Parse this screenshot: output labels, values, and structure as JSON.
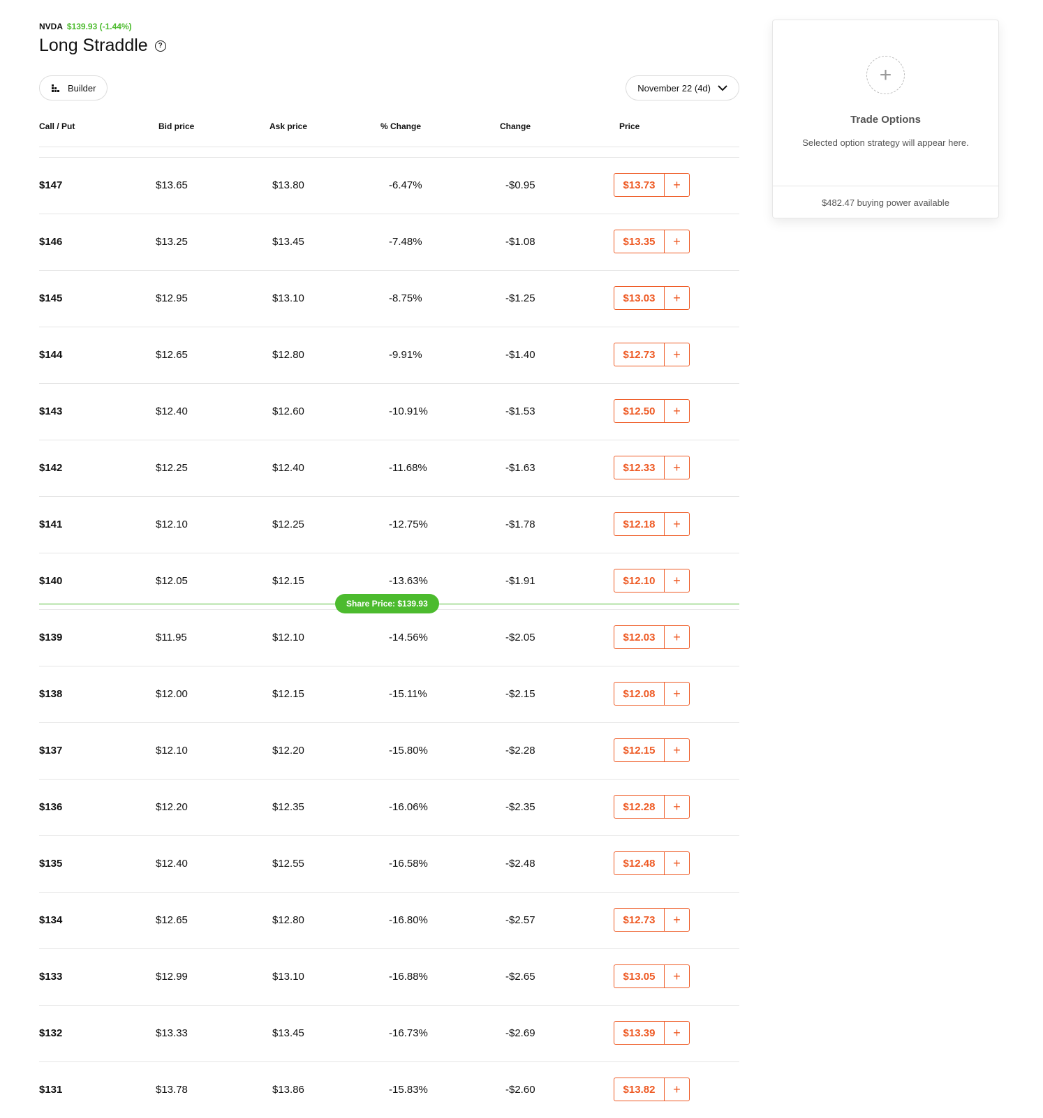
{
  "ticker": {
    "symbol": "NVDA",
    "quote": "$139.93 (-1.44%)"
  },
  "page": {
    "title": "Long Straddle",
    "help_glyph": "?"
  },
  "controls": {
    "builder_label": "Builder",
    "expiry_label": "November 22 (4d)"
  },
  "columns": [
    "Call / Put",
    "Bid price",
    "Ask price",
    "% Change",
    "Change",
    "Price"
  ],
  "rows": [
    {
      "strike": "$147",
      "bid": "$13.65",
      "ask": "$13.80",
      "pct_change": "-6.47%",
      "change": "-$0.95",
      "price": "$13.73"
    },
    {
      "strike": "$146",
      "bid": "$13.25",
      "ask": "$13.45",
      "pct_change": "-7.48%",
      "change": "-$1.08",
      "price": "$13.35"
    },
    {
      "strike": "$145",
      "bid": "$12.95",
      "ask": "$13.10",
      "pct_change": "-8.75%",
      "change": "-$1.25",
      "price": "$13.03"
    },
    {
      "strike": "$144",
      "bid": "$12.65",
      "ask": "$12.80",
      "pct_change": "-9.91%",
      "change": "-$1.40",
      "price": "$12.73"
    },
    {
      "strike": "$143",
      "bid": "$12.40",
      "ask": "$12.60",
      "pct_change": "-10.91%",
      "change": "-$1.53",
      "price": "$12.50"
    },
    {
      "strike": "$142",
      "bid": "$12.25",
      "ask": "$12.40",
      "pct_change": "-11.68%",
      "change": "-$1.63",
      "price": "$12.33"
    },
    {
      "strike": "$141",
      "bid": "$12.10",
      "ask": "$12.25",
      "pct_change": "-12.75%",
      "change": "-$1.78",
      "price": "$12.18"
    },
    {
      "strike": "$140",
      "bid": "$12.05",
      "ask": "$12.15",
      "pct_change": "-13.63%",
      "change": "-$1.91",
      "price": "$12.10"
    },
    {
      "strike": "$139",
      "bid": "$11.95",
      "ask": "$12.10",
      "pct_change": "-14.56%",
      "change": "-$2.05",
      "price": "$12.03"
    },
    {
      "strike": "$138",
      "bid": "$12.00",
      "ask": "$12.15",
      "pct_change": "-15.11%",
      "change": "-$2.15",
      "price": "$12.08"
    },
    {
      "strike": "$137",
      "bid": "$12.10",
      "ask": "$12.20",
      "pct_change": "-15.80%",
      "change": "-$2.28",
      "price": "$12.15"
    },
    {
      "strike": "$136",
      "bid": "$12.20",
      "ask": "$12.35",
      "pct_change": "-16.06%",
      "change": "-$2.35",
      "price": "$12.28"
    },
    {
      "strike": "$135",
      "bid": "$12.40",
      "ask": "$12.55",
      "pct_change": "-16.58%",
      "change": "-$2.48",
      "price": "$12.48"
    },
    {
      "strike": "$134",
      "bid": "$12.65",
      "ask": "$12.80",
      "pct_change": "-16.80%",
      "change": "-$2.57",
      "price": "$12.73"
    },
    {
      "strike": "$133",
      "bid": "$12.99",
      "ask": "$13.10",
      "pct_change": "-16.88%",
      "change": "-$2.65",
      "price": "$13.05"
    },
    {
      "strike": "$132",
      "bid": "$13.33",
      "ask": "$13.45",
      "pct_change": "-16.73%",
      "change": "-$2.69",
      "price": "$13.39"
    },
    {
      "strike": "$131",
      "bid": "$13.78",
      "ask": "$13.86",
      "pct_change": "-15.83%",
      "change": "-$2.60",
      "price": "$13.82"
    }
  ],
  "share_price": {
    "label": "Share Price: $139.93",
    "after_row_index": 7
  },
  "trade_panel": {
    "title": "Trade Options",
    "subtitle": "Selected option strategy will appear here.",
    "buying_power": "$482.47 buying power available"
  },
  "colors": {
    "accent": "#ee5a24",
    "positive": "#4cbb2e"
  },
  "icons": {
    "help": "help-icon",
    "builder": "bar-chart-icon",
    "expiry": "chevron-down-icon",
    "add": "plus-icon"
  }
}
